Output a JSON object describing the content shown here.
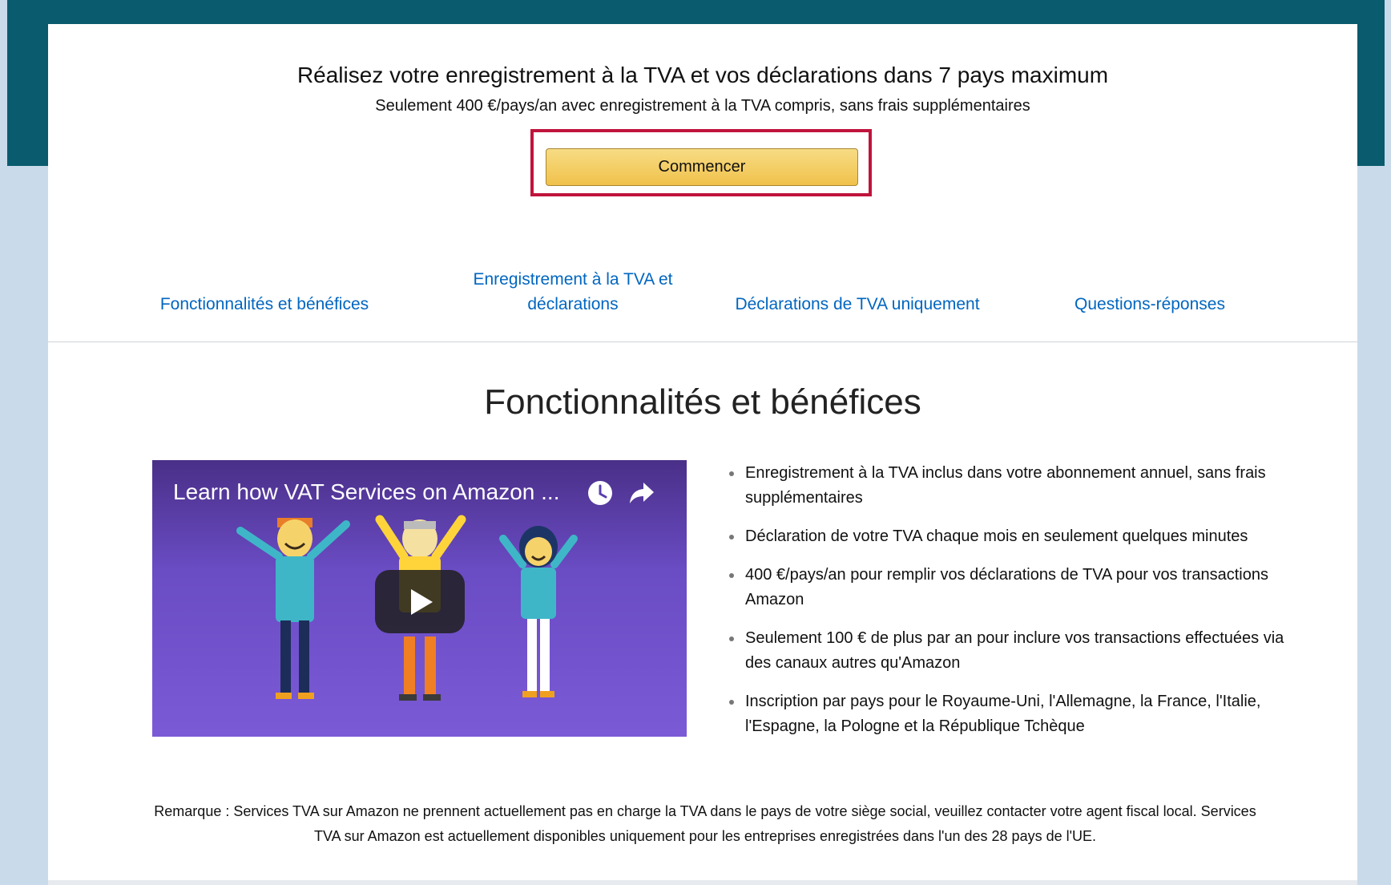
{
  "hero": {
    "title": "Réalisez votre enregistrement à la TVA et vos déclarations dans 7 pays maximum",
    "subtitle": "Seulement 400 €/pays/an avec enregistrement à la TVA compris, sans frais supplémentaires",
    "cta_label": "Commencer"
  },
  "nav": {
    "items": [
      {
        "label": "Fonctionnalités et bénéfices"
      },
      {
        "label": "Enregistrement à la TVA et déclarations"
      },
      {
        "label": "Déclarations de TVA uniquement"
      },
      {
        "label": "Questions-réponses"
      }
    ]
  },
  "section": {
    "title": "Fonctionnalités et bénéfices"
  },
  "video": {
    "title": "Learn how VAT Services on Amazon ...",
    "icons": [
      "clock-icon",
      "share-icon",
      "play-icon"
    ]
  },
  "bullets": [
    "Enregistrement à la TVA inclus dans votre abonnement annuel, sans frais supplémentaires",
    "Déclaration de votre TVA chaque mois en seulement quelques minutes",
    "400 €/pays/an pour remplir vos déclarations de TVA pour vos transactions Amazon",
    "Seulement 100 € de plus par an pour inclure vos transactions effectuées via des canaux autres qu'Amazon",
    "Inscription par pays pour le Royaume-Uni, l'Allemagne, la France, l'Italie, l'Espagne, la Pologne et la République Tchèque"
  ],
  "note": "Remarque : Services TVA sur Amazon ne prennent actuellement pas en charge la TVA dans le pays de votre siège social, veuillez contacter votre agent fiscal local. Services TVA sur Amazon est actuellement disponibles uniquement pour les entreprises enregistrées dans l'un des 28 pays de l'UE.",
  "colors": {
    "header_band": "#0b5b6e",
    "page_background": "#c9dbea",
    "link": "#0066c0",
    "button": "#f0c14b",
    "highlight_border": "#c0143c",
    "video_background": "#7b5ad6"
  }
}
